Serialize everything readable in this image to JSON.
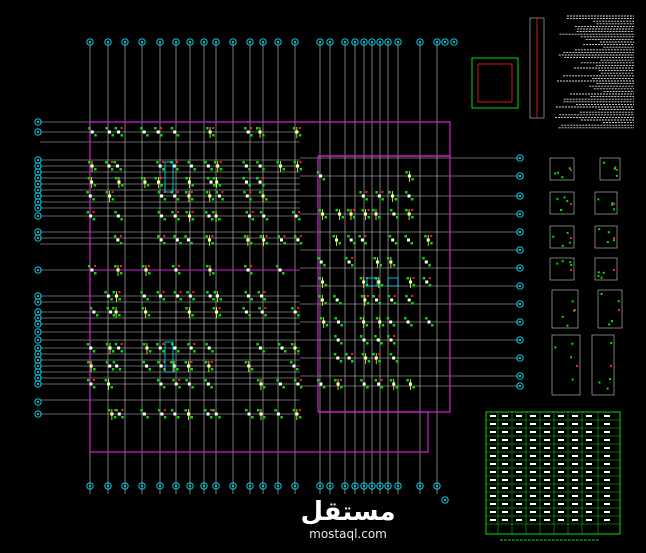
{
  "drawing": {
    "background": "#000000",
    "colors": {
      "grid_line": "#c8c8c8",
      "boundary": "#d020d0",
      "axis_bubble": "#00e6ff",
      "node_green": "#00e000",
      "node_red": "#ff2020",
      "node_white": "#ffffff",
      "node_yellow": "#ffff30",
      "note_text": "#e0e0e0",
      "table_border": "#00e000"
    }
  },
  "watermark": {
    "arabic": "مستقل",
    "url": "mostaql.com"
  }
}
